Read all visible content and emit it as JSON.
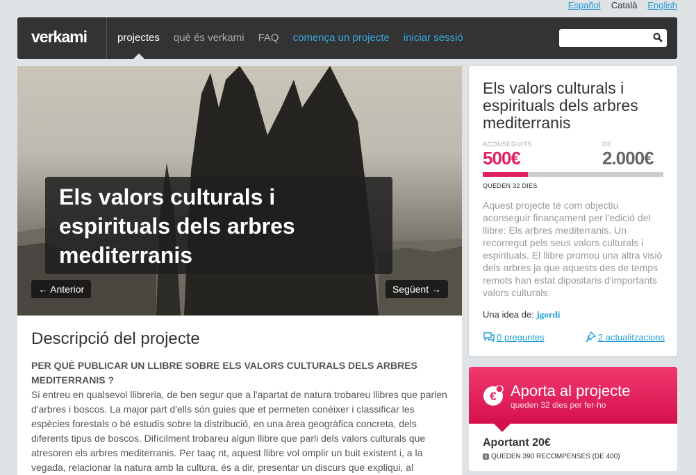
{
  "languages": {
    "es": "Español",
    "ca": "Català",
    "en": "English"
  },
  "nav": {
    "logo": "verkami",
    "items": [
      "projectes",
      "què és verkami",
      "FAQ",
      "comença un projecte",
      "iniciar sessió"
    ],
    "search_placeholder": ""
  },
  "hero": {
    "title": "Els valors culturals i espirituals dels arbres mediterranis",
    "prev": "← Anterior",
    "next": "Següent →"
  },
  "description": {
    "heading": "Descripció del projecte",
    "question": "PER QUÈ PUBLICAR UN LLIBRE SOBRE ELS VALORS CULTURALS DELS ARBRES MEDITERRANIS ?",
    "body": "Si entreu en qualsevol llibreria, de ben segur que a l'apartat de natura trobareu llibres que parlen d'arbres i boscos. La major part d'ells són guies que et permeten conèixer i classificar les espècies forestals o bé estudis sobre la distribució, en una àrea geogràfica concreta, dels diferents tipus de boscos. Difícilment trobareu algun llibre que parli dels valors culturals que atresoren els arbres mediterranis. Per taaç nt, aquest llibre vol omplir un buit existent i, a la vegada, relacionar la natura amb la cultura, és a dir, presentar un discurs que expliqui, al"
  },
  "project": {
    "title": "Els valors culturals i espirituals dels arbres mediterranis",
    "raised_label": "ACONSEGUITS",
    "raised": "500€",
    "goal_label": "DE",
    "goal": "2.000€",
    "progress": 0.25,
    "days_left": "QUEDEN 32 DIES",
    "summary": "Aquest projecte té com objectiu aconseguir finançament per l'edició del llibre: Els arbres mediterranis. Un recorregut pels seus valors culturals i espirituals. El llibre promou una altra visió dels arbres ja que aquests des de temps remots han estat dipositaris d'importants valors culturals.",
    "idea_label": "Una idea de:",
    "author": "jgordi",
    "questions": "0 preguntes",
    "updates": "2 actualitzacions"
  },
  "contribute": {
    "title": "Aporta al projecte",
    "subtitle": "queden 32 dies per fer-ho",
    "reward_title": "Aportant 20€",
    "reward_sub": "QUEDEN 390 RECOMPENSES (DE 400)"
  },
  "colors": {
    "accent": "#e0235f",
    "link": "#1e9bd7",
    "nav": "#333333"
  }
}
